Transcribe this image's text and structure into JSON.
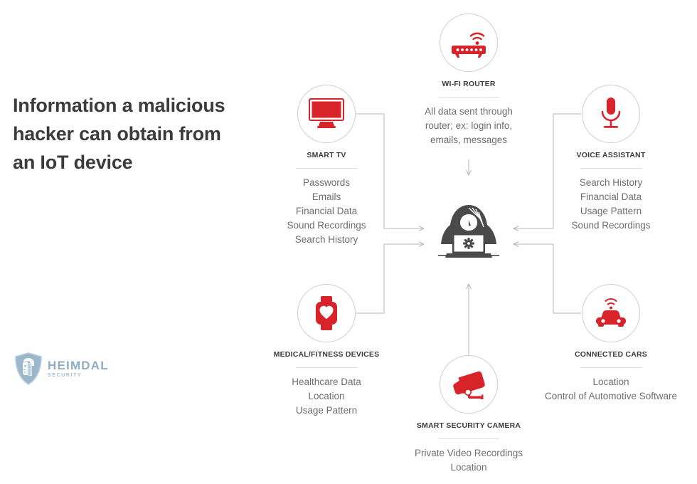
{
  "title": "Information a malicious hacker can obtain from an IoT device",
  "brand": {
    "name": "HEIMDAL",
    "tagline": "SECURITY",
    "logo_icon": "shield-viking-icon",
    "color": "#8fadc4"
  },
  "colors": {
    "accent_red": "#d8232a",
    "text_dark": "#3b3b3d",
    "text_body": "#6d6e71",
    "line": "#b6b6b6",
    "circle_border": "#cfcfcf",
    "hacker": "#4a4a4a"
  },
  "center": {
    "name": "malicious-hacker",
    "icon": "hooded-hacker-with-laptop-icon"
  },
  "nodes": [
    {
      "id": "smart-tv",
      "label": "SMART TV",
      "icon": "television-icon",
      "items": [
        "Passwords",
        "Emails",
        "Financial Data",
        "Sound Recordings",
        "Search History"
      ]
    },
    {
      "id": "wifi-router",
      "label": "WI-FI ROUTER",
      "icon": "wifi-router-icon",
      "items": [
        "All data sent through",
        "router; ex: login info,",
        "emails, messages"
      ]
    },
    {
      "id": "voice-assistant",
      "label": "VOICE ASSISTANT",
      "icon": "microphone-icon",
      "items": [
        "Search History",
        "Financial Data",
        "Usage Pattern",
        "Sound Recordings"
      ]
    },
    {
      "id": "medical-fitness-devices",
      "label": "MEDICAL/FITNESS DEVICES",
      "icon": "smartwatch-heart-icon",
      "items": [
        "Healthcare Data",
        "Location",
        "Usage Pattern"
      ]
    },
    {
      "id": "smart-security-camera",
      "label": "SMART SECURITY CAMERA",
      "icon": "cctv-camera-icon",
      "items": [
        "Private Video Recordings",
        "Location"
      ]
    },
    {
      "id": "connected-cars",
      "label": "CONNECTED CARS",
      "icon": "car-wifi-icon",
      "items": [
        "Location",
        "Control of Automotive Software"
      ]
    }
  ]
}
